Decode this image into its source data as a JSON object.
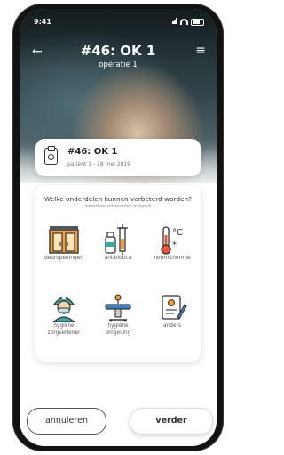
{
  "status": {
    "time": "9:41"
  },
  "nav": {
    "back": "←",
    "title": "#46: OK 1",
    "subtitle": "operatie 1",
    "menu": "≡"
  },
  "patient": {
    "title": "#46: OK 1",
    "meta": "patiënt 1 - 28 mei 2019"
  },
  "question": {
    "text": "Welke onderdelen kunnen verbeterd worden?",
    "hint": "meerdere antwoorden mogelijk"
  },
  "options": [
    {
      "label": "deuropeningen",
      "icon": "doors-icon"
    },
    {
      "label": "antibiotica",
      "icon": "antibiotics-icon"
    },
    {
      "label": "normothermie",
      "icon": "thermometer-icon"
    },
    {
      "label_1": "hygiëne",
      "label_2": "zorgverlener",
      "icon": "caregiver-icon"
    },
    {
      "label_1": "hygiëne",
      "label_2": "omgeving",
      "icon": "operating-table-icon"
    },
    {
      "label": "anders",
      "icon": "notepad-icon"
    }
  ],
  "buttons": {
    "cancel": "annuleren",
    "next": "verder"
  },
  "colors": {
    "accent_orange": "#f29a2e",
    "accent_teal": "#3aa7a3",
    "accent_blue": "#3f7fbf"
  }
}
